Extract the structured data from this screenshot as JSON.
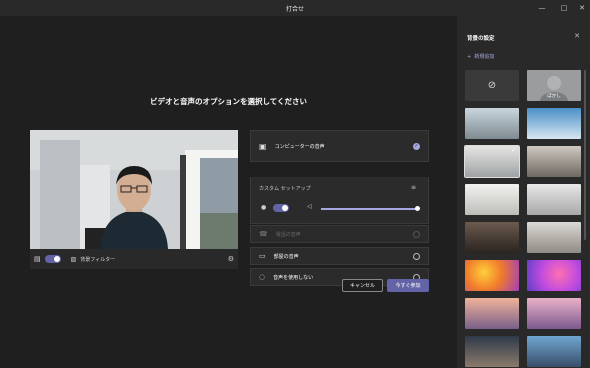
{
  "window": {
    "title": "打合せ"
  },
  "main": {
    "heading": "ビデオと音声のオプションを選択してください",
    "video_bar": {
      "bg_filter_label": "背景フィルター"
    },
    "audio_options": [
      {
        "label": "コンピューターの音声",
        "checked": true,
        "disabled": false
      },
      {
        "label": "電話の音声",
        "checked": false,
        "disabled": true
      },
      {
        "label": "部屋の音声",
        "checked": false,
        "disabled": false
      },
      {
        "label": "音声を使用しない",
        "checked": false,
        "disabled": false
      }
    ],
    "custom_setup_label": "カスタム セットアップ",
    "speaker_volume": 1.0,
    "cancel_label": "キャンセル",
    "join_label": "今すぐ参加"
  },
  "panel": {
    "title": "背景の設定",
    "add_new_label": "新規追加",
    "tiles": [
      {
        "name": "none",
        "label": ""
      },
      {
        "name": "blur",
        "label": "ぼかし"
      },
      {
        "name": "office-room",
        "label": ""
      },
      {
        "name": "blue-interior",
        "label": ""
      },
      {
        "name": "white-room",
        "label": "",
        "selected": true
      },
      {
        "name": "living-room",
        "label": ""
      },
      {
        "name": "bright-room",
        "label": ""
      },
      {
        "name": "white-hall",
        "label": ""
      },
      {
        "name": "dark-office",
        "label": ""
      },
      {
        "name": "loft",
        "label": ""
      },
      {
        "name": "balloons-orange",
        "label": ""
      },
      {
        "name": "balloons-pink",
        "label": ""
      },
      {
        "name": "bridge",
        "label": ""
      },
      {
        "name": "fantasy",
        "label": ""
      },
      {
        "name": "night-city",
        "label": ""
      },
      {
        "name": "futuristic",
        "label": ""
      }
    ]
  },
  "colors": {
    "accent": "#6264a7",
    "accent_light": "#a6a8e0",
    "panel_bg": "#292929",
    "main_bg": "#1f1f1f"
  }
}
